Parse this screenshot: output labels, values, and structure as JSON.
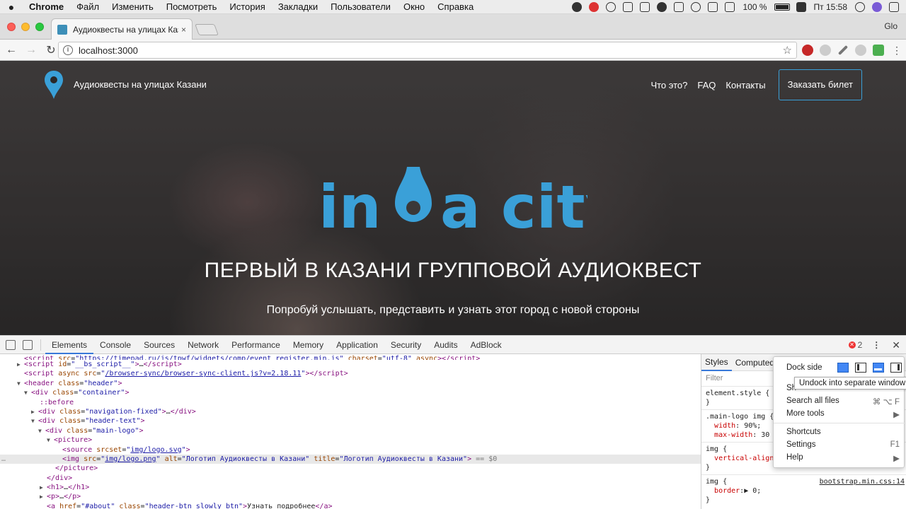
{
  "menubar": {
    "apple": "",
    "items": [
      "Chrome",
      "Файл",
      "Изменить",
      "Посмотреть",
      "История",
      "Закладки",
      "Пользователи",
      "Окно",
      "Справка"
    ],
    "battery": "100 %",
    "clock": "Пт 15:58"
  },
  "browser": {
    "tab_title": "Аудиоквесты на улицах Казани",
    "tab_close": "×",
    "profile": "Glo",
    "url": "localhost:3000",
    "back": "←",
    "forward": "→",
    "reload": "↻",
    "info": "i",
    "star": "☆"
  },
  "site": {
    "name": "Аудиоквесты на улицах Казани",
    "nav": [
      "Что это?",
      "FAQ",
      "Контакты"
    ],
    "cta": "Заказать билет",
    "brand_left": "in ",
    "brand_d": "d",
    "brand_right": "a city",
    "headline": "ПЕРВЫЙ В КАЗАНИ ГРУППОВОЙ АУДИОКВЕСТ",
    "subline": "Попробуй услышать, представить и узнать этот город с новой стороны",
    "accent": "#3aa0d8"
  },
  "devtools": {
    "tabs": [
      "Elements",
      "Console",
      "Sources",
      "Network",
      "Performance",
      "Memory",
      "Application",
      "Security",
      "Audits",
      "AdBlock"
    ],
    "error_count": "2",
    "kebab": "⋮",
    "close": "✕",
    "styles_tabs": [
      "Styles",
      "Computed"
    ],
    "filter": "Filter",
    "source_link": "bootstrap.min.css:14"
  },
  "popup": {
    "dock_side": "Dock side",
    "tooltip": "Undock into separate window",
    "show_partial": "Sh",
    "items": [
      {
        "label": "Search all files",
        "shortcut": "⌘ ⌥ F"
      },
      {
        "label": "More tools",
        "shortcut": "▶"
      },
      {
        "label": "Shortcuts",
        "shortcut": ""
      },
      {
        "label": "Settings",
        "shortcut": "F1"
      },
      {
        "label": "Help",
        "shortcut": "▶"
      }
    ]
  }
}
